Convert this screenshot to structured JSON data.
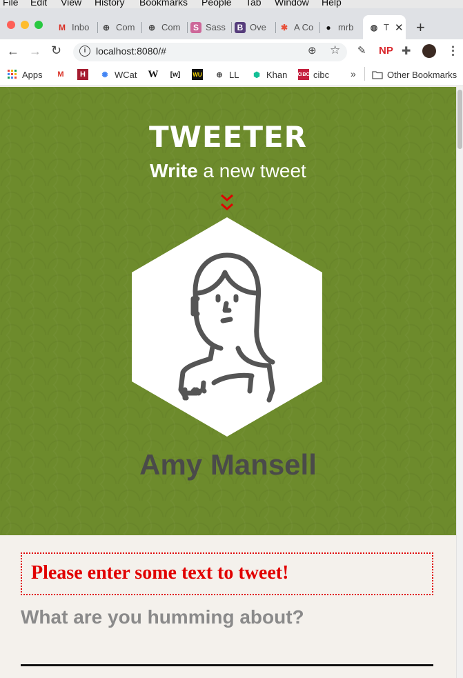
{
  "menubar": [
    "File",
    "Edit",
    "View",
    "History",
    "Bookmarks",
    "People",
    "Tab",
    "Window",
    "Help"
  ],
  "tabs": [
    {
      "label": "Inbo",
      "icon": "gmail-icon",
      "glyph": "M",
      "color": "#d93025"
    },
    {
      "label": "Com",
      "icon": "globe-plus-icon",
      "glyph": "⊕",
      "color": "#444"
    },
    {
      "label": "Com",
      "icon": "globe-plus-icon",
      "glyph": "⊕",
      "color": "#444"
    },
    {
      "label": "Sass",
      "icon": "sass-icon",
      "glyph": "S",
      "color": "#cd6799"
    },
    {
      "label": "Ove",
      "icon": "bootstrap-icon",
      "glyph": "B",
      "color": "#563d7c"
    },
    {
      "label": "A Co",
      "icon": "asterisk-icon",
      "glyph": "✱",
      "color": "#e8503a"
    },
    {
      "label": "mrb",
      "icon": "github-icon",
      "glyph": "●",
      "color": "#111"
    },
    {
      "label": "T",
      "icon": "globe-icon",
      "glyph": "◍",
      "color": "#444"
    }
  ],
  "url": "localhost:8080/#",
  "bookmarks": [
    {
      "label": "Apps",
      "icon": "apps-grid-icon"
    },
    {
      "label": "",
      "icon": "gmail-icon"
    },
    {
      "label": "",
      "icon": "harvard-icon"
    },
    {
      "label": "WCat",
      "icon": "worldcat-icon"
    },
    {
      "label": "",
      "icon": "wikipedia-icon"
    },
    {
      "label": "",
      "icon": "wiktionary-icon"
    },
    {
      "label": "",
      "icon": "western-union-icon"
    },
    {
      "label": "LL",
      "icon": "globe-plus-icon"
    },
    {
      "label": "Khan",
      "icon": "khan-icon"
    },
    {
      "label": "cibc",
      "icon": "cibc-icon"
    },
    {
      "label": "Other Bookmarks",
      "icon": "folder-icon"
    }
  ],
  "extensions_badge": "NP",
  "page": {
    "brand": "TWEETER",
    "subtitle_bold": "Write",
    "subtitle_rest": " a new tweet",
    "user_name": "Amy Mansell",
    "error_message": "Please enter some text to tweet!",
    "composer_placeholder": "What are you humming about?"
  },
  "colors": {
    "hero_green": "#6d8b2c",
    "error_red": "#e10000",
    "chevron_red": "#e10000"
  }
}
